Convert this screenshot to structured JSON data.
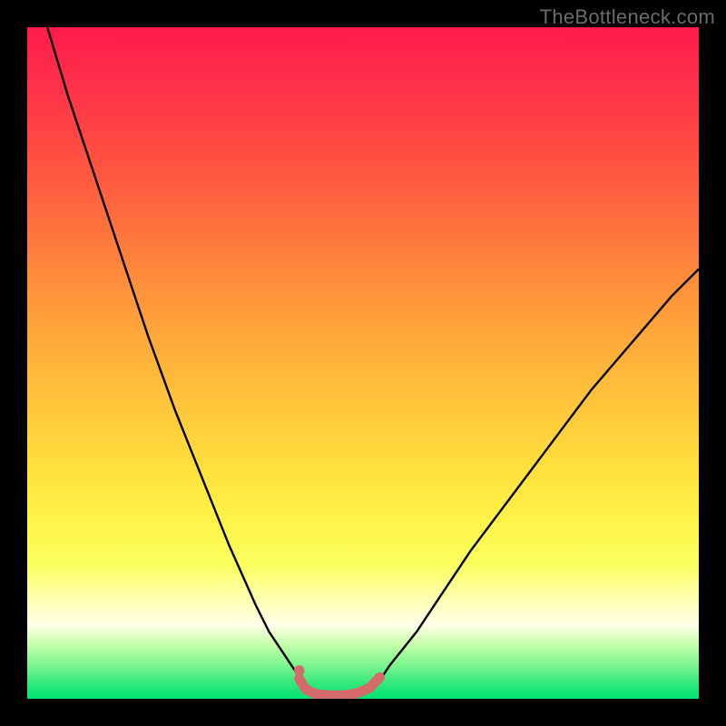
{
  "watermark": "TheBottleneck.com",
  "chart_data": {
    "type": "line",
    "title": "",
    "xlabel": "",
    "ylabel": "",
    "xlim": [
      0,
      100
    ],
    "ylim": [
      0,
      100
    ],
    "grid": false,
    "legend": false,
    "background": "rainbow-gradient",
    "series": [
      {
        "name": "left-curve",
        "stroke": "#000000",
        "stroke_width": 2.4,
        "x": [
          3,
          6,
          10,
          14,
          18,
          22,
          26,
          30,
          34,
          36,
          38,
          40,
          41
        ],
        "y": [
          100,
          90,
          78,
          66,
          54,
          43,
          33,
          23,
          14,
          10,
          7,
          4,
          2
        ]
      },
      {
        "name": "right-curve",
        "stroke": "#000000",
        "stroke_width": 2.4,
        "x": [
          52,
          54,
          58,
          62,
          66,
          72,
          78,
          84,
          90,
          96,
          100
        ],
        "y": [
          2,
          5,
          10,
          16,
          22,
          30,
          38,
          46,
          53,
          60,
          64
        ]
      },
      {
        "name": "bottom-accent",
        "stroke": "#d46a6a",
        "stroke_width": 11,
        "linecap": "round",
        "x": [
          40.5,
          41.5,
          43,
          45,
          47,
          49,
          51,
          52.5
        ],
        "y": [
          3,
          1.4,
          0.7,
          0.5,
          0.5,
          0.8,
          1.6,
          3.2
        ]
      }
    ],
    "markers": [
      {
        "x": 40.5,
        "y": 4.2,
        "r": 5.8,
        "fill": "#d46a6a"
      }
    ]
  }
}
